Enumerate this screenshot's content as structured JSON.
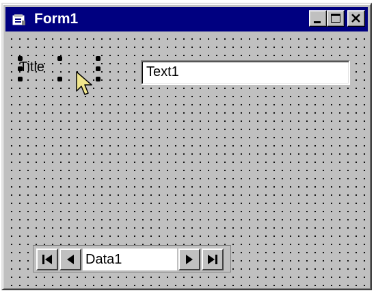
{
  "window": {
    "title": "Form1",
    "icon": "form-icon",
    "title_bar_color": "#000080"
  },
  "title_bar_buttons": {
    "minimize": "minimize-icon",
    "maximize": "maximize-icon",
    "close": "close-icon"
  },
  "form": {
    "background_color": "#c0c0c0",
    "grid": "dotted",
    "label": {
      "caption": "Title",
      "selected": true
    },
    "textbox": {
      "text": "Text1"
    },
    "data_control": {
      "caption": "Data1",
      "buttons": [
        "first-record-icon",
        "previous-record-icon",
        "next-record-icon",
        "last-record-icon"
      ]
    }
  },
  "cursor": "arrow-pointer-icon"
}
